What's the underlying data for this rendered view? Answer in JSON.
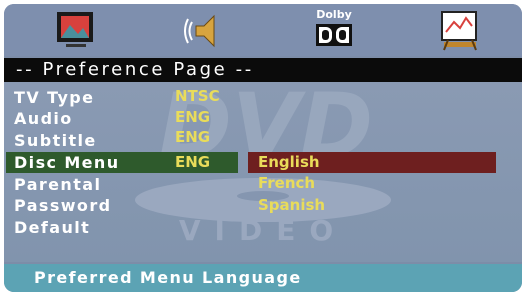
{
  "icons": {
    "picture": "picture-icon",
    "audio": "speaker-icon",
    "dolby": "dolby-icon",
    "preferences": "easel-icon",
    "dolby_text": "Dolby"
  },
  "page_title": "-- Preference Page --",
  "watermark": {
    "text": "VIDEO"
  },
  "menu": {
    "items": [
      {
        "label": "TV Type",
        "value": "NTSC"
      },
      {
        "label": "Audio",
        "value": "ENG"
      },
      {
        "label": "Subtitle",
        "value": "ENG"
      },
      {
        "label": "Disc Menu",
        "value": "ENG"
      },
      {
        "label": "Parental",
        "value": ""
      },
      {
        "label": "Password",
        "value": ""
      },
      {
        "label": "Default",
        "value": ""
      }
    ],
    "selected_index": 3
  },
  "options": {
    "items": [
      "English",
      "French",
      "Spanish"
    ],
    "selected_index": 0
  },
  "status": {
    "text": "Preferred Menu Language"
  },
  "colors": {
    "background": "#7d8da8",
    "label_text": "#ffffff",
    "value_text": "#e9dc5a",
    "row_highlight": "#2e5a2c",
    "option_highlight": "#6e1f1f",
    "status_bar": "#5ca3b4",
    "title_bar": "#0b0b0b"
  }
}
